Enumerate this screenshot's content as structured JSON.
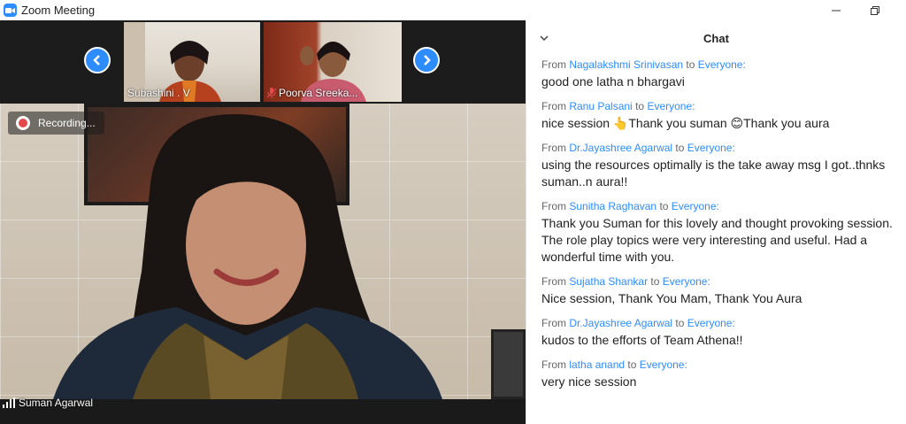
{
  "window": {
    "title": "Zoom Meeting"
  },
  "participants": {
    "thumbnails": [
      {
        "name": "Subashini . V"
      },
      {
        "name": "Poorva Sreeka..."
      }
    ],
    "main": {
      "name": "Suman Agarwal"
    }
  },
  "status": {
    "recording": "Recording..."
  },
  "chat": {
    "title": "Chat",
    "messages": [
      {
        "prefix": "From",
        "sender": "Nagalakshmi Srinivasan",
        "to_word": "to",
        "recipient": "Everyone:",
        "text": "good one latha n  bhargavi"
      },
      {
        "prefix": "From",
        "sender": "Ranu Palsani",
        "to_word": "to",
        "recipient": "Everyone:",
        "text": "nice session 👆Thank you suman 😊Thank you aura"
      },
      {
        "prefix": "From",
        "sender": "Dr.Jayashree Agarwal",
        "to_word": "to",
        "recipient": "Everyone:",
        "text": "using the resources optimally is the take away msg I got..thnks suman..n aura!!"
      },
      {
        "prefix": "From",
        "sender": "Sunitha Raghavan",
        "to_word": "to",
        "recipient": "Everyone:",
        "text": "Thank you Suman for this lovely and thought provoking session. The role play topics were very interesting and useful. Had a wonderful time with you."
      },
      {
        "prefix": "From",
        "sender": "Sujatha Shankar",
        "to_word": "to",
        "recipient": "Everyone:",
        "text": "Nice session, Thank You Mam, Thank You Aura"
      },
      {
        "prefix": "From",
        "sender": "Dr.Jayashree Agarwal",
        "to_word": "to",
        "recipient": "Everyone:",
        "text": "kudos to the efforts of Team Athena!!"
      },
      {
        "prefix": "From",
        "sender": "latha anand",
        "to_word": "to",
        "recipient": "Everyone:",
        "text": "very nice session"
      }
    ]
  },
  "colors": {
    "accent": "#2d8cff",
    "recording": "#e5484d"
  }
}
